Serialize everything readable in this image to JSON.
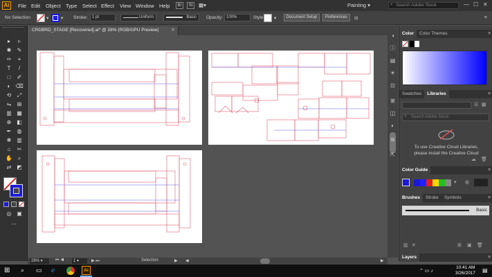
{
  "app": {
    "logo": "Ai",
    "workspace": "Painting",
    "workspace_caret": "▾"
  },
  "menu": [
    "File",
    "Edit",
    "Object",
    "Type",
    "Select",
    "Effect",
    "View",
    "Window",
    "Help"
  ],
  "menu_buttons": [
    "Br",
    "St"
  ],
  "search": {
    "placeholder": "Search Adobe Stock"
  },
  "window_controls": [
    "—",
    "☐",
    "✕"
  ],
  "control_bar": {
    "selection": "No Selection",
    "stroke_label": "Stroke:",
    "stroke_weight": "1 pt",
    "stroke_profile": "Uniform",
    "brush": "Basic",
    "opacity_label": "Opacity:",
    "opacity_value": "100%",
    "style_label": "Style:",
    "document_setup": "Document Setup",
    "preferences": "Preferences"
  },
  "document": {
    "tab_title": "CRDBRD_STAGE [Recovered].ai* @ 28% (RGB/GPU Preview)",
    "close": "✕"
  },
  "tools": [
    "▸",
    "▹",
    "✱",
    "✎",
    "✑",
    "⌖",
    "T",
    "/",
    "□",
    "✐",
    "◐",
    "⟲",
    "⤢",
    "⊞",
    "✋",
    "⌕",
    "◧",
    "◍",
    "▦",
    "▥",
    "⊕",
    "⌂",
    "✂",
    "⋯"
  ],
  "status": {
    "zoom": "28%",
    "artboard": "1",
    "tool": "Selection"
  },
  "panels": {
    "color_tab": "Color",
    "color_themes_tab": "Color Themes",
    "swatches_tab": "Swatches",
    "libraries_tab": "Libraries",
    "libraries_search": "Search Adobe Stock",
    "libraries_message": "To use Creative Cloud Libraries, please install the Creative Cloud",
    "color_guide_tab": "Color Guide",
    "brushes_tab": "Brushes",
    "stroke_tab": "Stroke",
    "symbols_tab": "Symbols",
    "brush_name": "Basic",
    "layers_tab": "Layers"
  },
  "colors": {
    "accent": "#1a1ad8",
    "brand": "#ff9a00",
    "cut_line": "#e05a6e",
    "score_line": "#5a5ae8"
  },
  "taskbar": {
    "time": "10:41 AM",
    "date": "3/26/2017"
  }
}
